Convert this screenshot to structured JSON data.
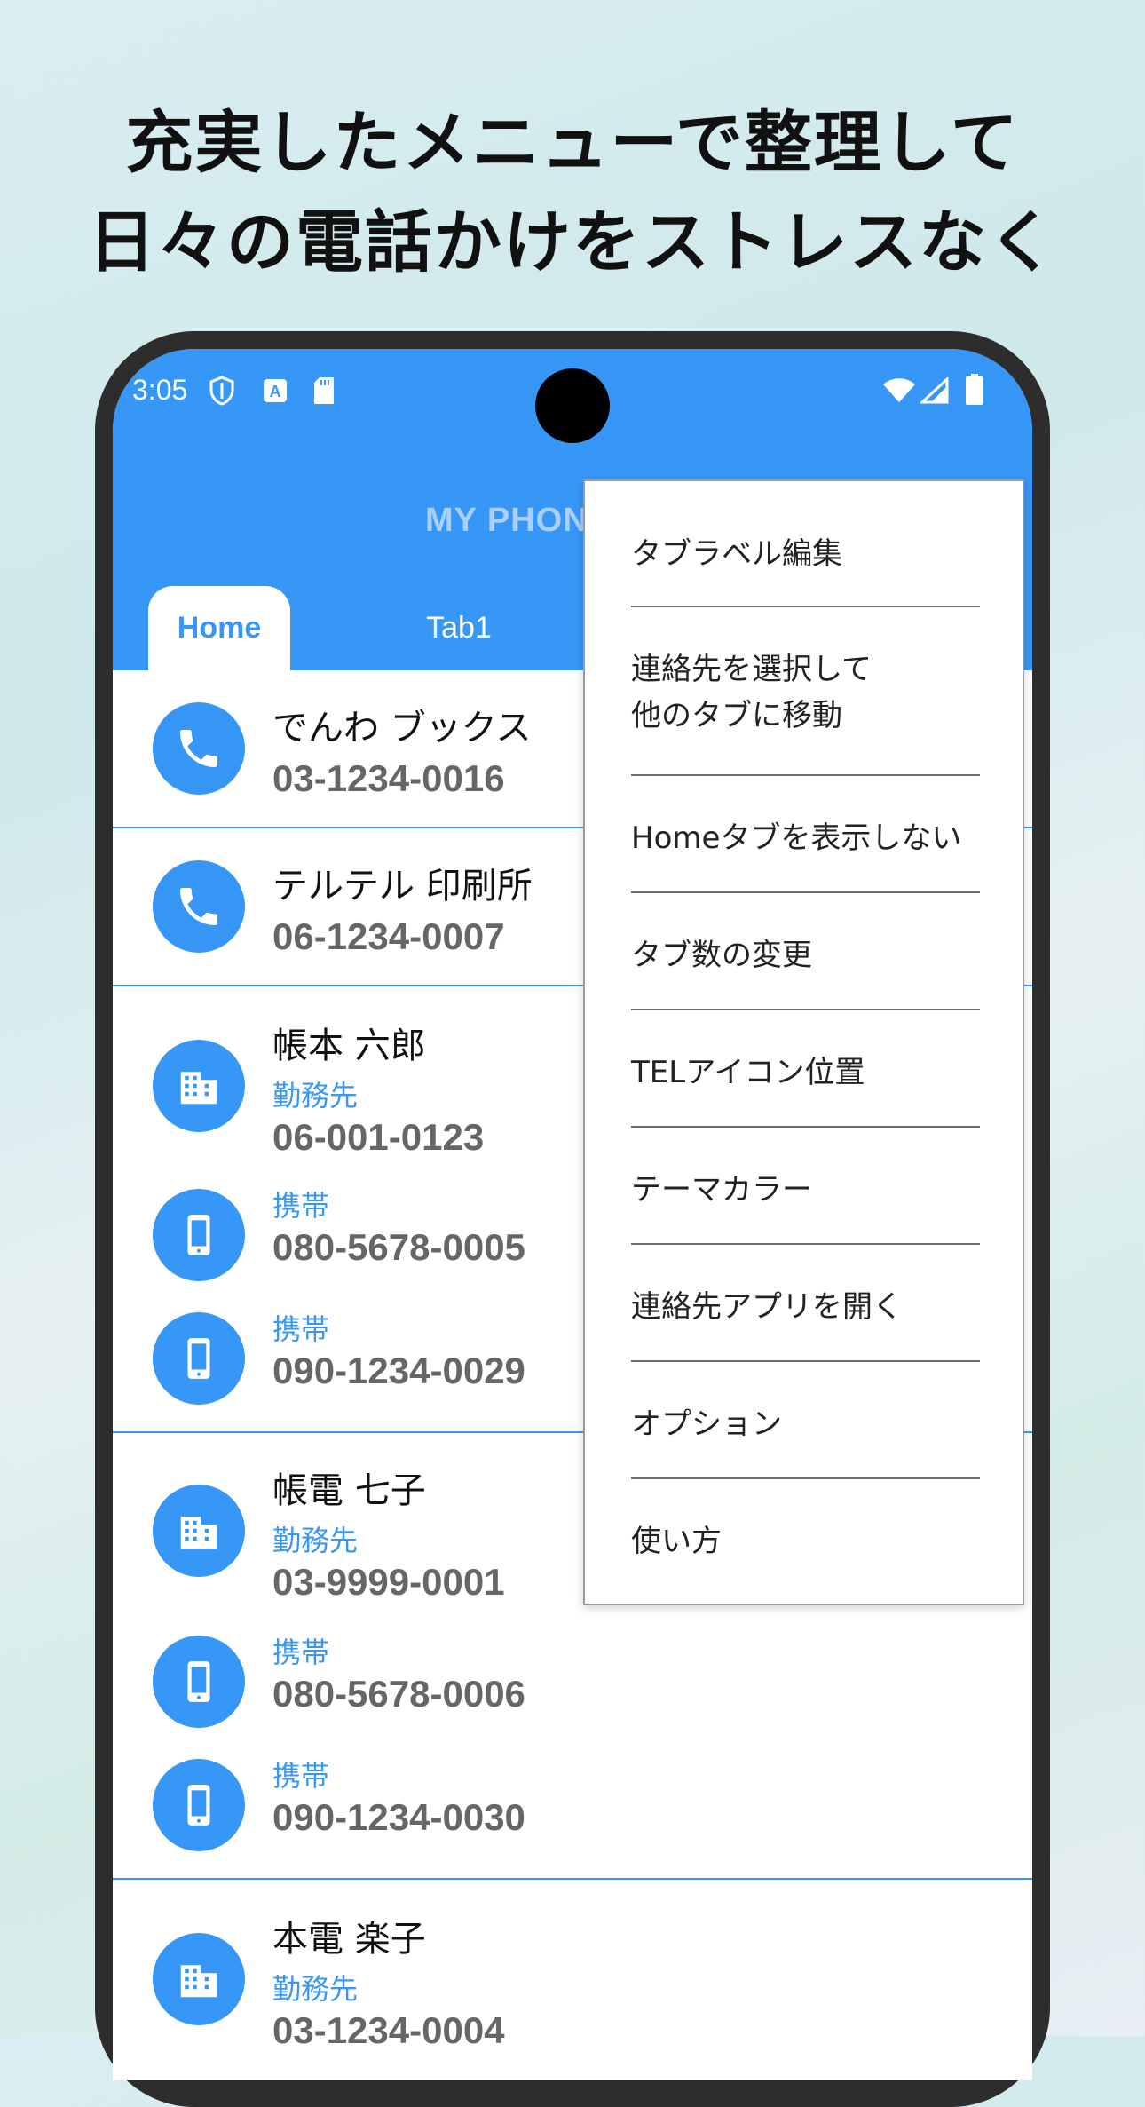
{
  "headline": {
    "line1": "充実したメニューで整理して",
    "line2": "日々の電話かけをストレスなく"
  },
  "status_bar": {
    "time": "3:05",
    "left_icons": [
      "shield-icon",
      "a-icon",
      "sd-card-icon"
    ],
    "right_icons": [
      "wifi-icon",
      "signal-icon",
      "battery-icon"
    ]
  },
  "app": {
    "title": "MY PHON",
    "accent_color": "#3797f7",
    "tabs": [
      {
        "label": "Home",
        "selected": true
      },
      {
        "label": "Tab1",
        "selected": false
      }
    ]
  },
  "contacts": [
    {
      "name": "でんわ ブックス",
      "entries": [
        {
          "icon": "phone-icon",
          "label": "",
          "number": "03-1234-0016"
        }
      ]
    },
    {
      "name": "テルテル 印刷所",
      "entries": [
        {
          "icon": "phone-icon",
          "label": "",
          "number": "06-1234-0007"
        }
      ]
    },
    {
      "name": "帳本 六郎",
      "entries": [
        {
          "icon": "building-icon",
          "label": "勤務先",
          "number": "06-001-0123"
        },
        {
          "icon": "mobile-icon",
          "label": "携帯",
          "number": "080-5678-0005"
        },
        {
          "icon": "mobile-icon",
          "label": "携帯",
          "number": "090-1234-0029"
        }
      ]
    },
    {
      "name": "帳電 七子",
      "entries": [
        {
          "icon": "building-icon",
          "label": "勤務先",
          "number": "03-9999-0001"
        },
        {
          "icon": "mobile-icon",
          "label": "携帯",
          "number": "080-5678-0006"
        },
        {
          "icon": "mobile-icon",
          "label": "携帯",
          "number": "090-1234-0030"
        }
      ]
    },
    {
      "name": "本電 楽子",
      "entries": [
        {
          "icon": "building-icon",
          "label": "勤務先",
          "number": "03-1234-0004"
        }
      ]
    }
  ],
  "menu": {
    "items": [
      "タブラベル編集",
      "連絡先を選択して\n他のタブに移動",
      "Homeタブを表示しない",
      "タブ数の変更",
      "TELアイコン位置",
      "テーマカラー",
      "連絡先アプリを開く",
      "オプション",
      "使い方"
    ]
  }
}
